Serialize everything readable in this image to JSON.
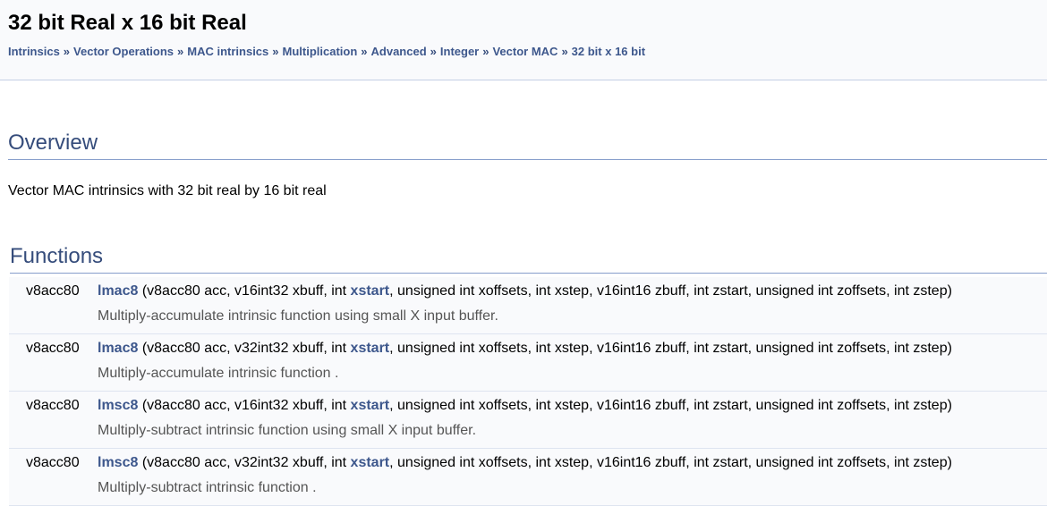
{
  "header": {
    "title": "32 bit Real x 16 bit Real",
    "breadcrumb": [
      "Intrinsics",
      "Vector Operations",
      "MAC intrinsics",
      "Multiplication",
      "Advanced",
      "Integer",
      "Vector MAC",
      "32 bit x 16 bit"
    ],
    "separator": "»"
  },
  "overview": {
    "heading": "Overview",
    "text": "Vector MAC intrinsics with 32 bit real by 16 bit real"
  },
  "functions": {
    "heading": "Functions",
    "rows": [
      {
        "ret": "v8acc80",
        "name": "lmac8",
        "params_a": " (v8acc80 acc, v16int32 xbuff, int ",
        "param_link": "xstart",
        "params_b": ", unsigned int xoffsets, int xstep, v16int16 zbuff, int zstart, unsigned int zoffsets, int zstep)",
        "desc": "Multiply-accumulate intrinsic function using small X input buffer."
      },
      {
        "ret": "v8acc80",
        "name": "lmac8",
        "params_a": " (v8acc80 acc, v32int32 xbuff, int ",
        "param_link": "xstart",
        "params_b": ", unsigned int xoffsets, int xstep, v16int16 zbuff, int zstart, unsigned int zoffsets, int zstep)",
        "desc": "Multiply-accumulate intrinsic function ."
      },
      {
        "ret": "v8acc80",
        "name": "lmsc8",
        "params_a": " (v8acc80 acc, v16int32 xbuff, int ",
        "param_link": "xstart",
        "params_b": ", unsigned int xoffsets, int xstep, v16int16 zbuff, int zstart, unsigned int zoffsets, int zstep)",
        "desc": "Multiply-subtract intrinsic function using small X input buffer."
      },
      {
        "ret": "v8acc80",
        "name": "lmsc8",
        "params_a": " (v8acc80 acc, v32int32 xbuff, int ",
        "param_link": "xstart",
        "params_b": ", unsigned int xoffsets, int xstep, v16int16 zbuff, int zstart, unsigned int zoffsets, int zstep)",
        "desc": "Multiply-subtract intrinsic function ."
      }
    ]
  }
}
